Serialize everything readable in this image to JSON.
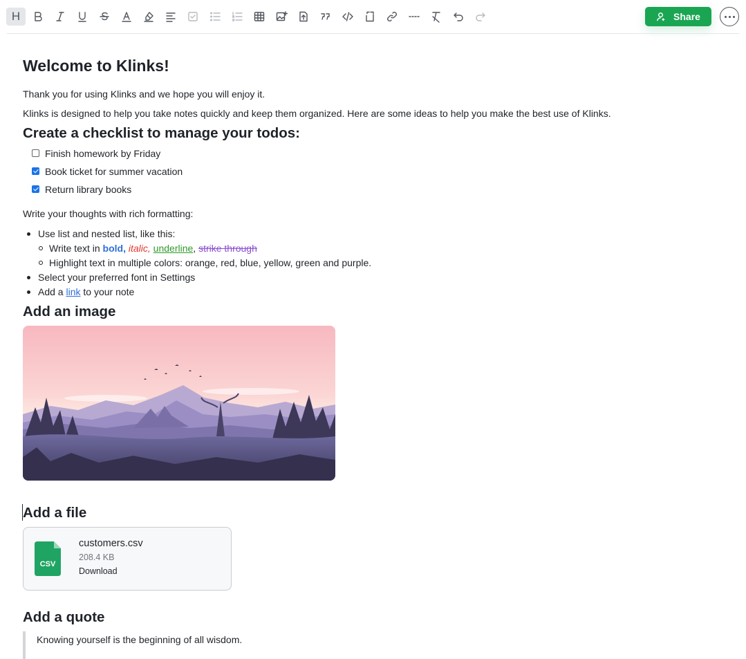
{
  "toolbar": {
    "heading_label": "H",
    "share_label": "Share"
  },
  "note": {
    "title": "Welcome to Klinks!",
    "intro_1": "Thank you for using Klinks and we hope you will enjoy it.",
    "intro_2": "Klinks is designed to help you take notes quickly and keep them organized. Here are some ideas to help you make the best use of Klinks.",
    "checklist_heading": "Create a checklist to manage your todos:",
    "checklist": [
      {
        "label": "Finish homework by Friday",
        "checked": false
      },
      {
        "label": "Book ticket for summer vacation",
        "checked": true
      },
      {
        "label": "Return library books",
        "checked": true
      }
    ],
    "rich_intro": "Write your thoughts with rich formatting:",
    "list_1": "Use list and nested list, like this:",
    "nested_1_prefix": "Write text in ",
    "bold": "bold,",
    "italic": "italic,",
    "underline": "underline",
    "comma": ",",
    "strike": "strike through",
    "nested_2": "Highlight text in multiple colors: orange, red, blue, yellow, green and purple.",
    "list_2": "Select your preferred font in Settings",
    "list_3_prefix": "Add a ",
    "list_3_link": "link",
    "list_3_suffix": " to your note",
    "image_heading": "Add an image",
    "file_heading": "Add a file",
    "file": {
      "icon_text": "CSV",
      "name": "customers.csv",
      "size": "208.4 KB",
      "download": "Download"
    },
    "quote_heading": "Add a quote",
    "quote_text": "Knowing yourself is the beginning of all wisdom."
  },
  "colors": {
    "share_green": "#1aa552",
    "csv_green": "#1fa463",
    "link_blue": "#2e6fd8"
  }
}
